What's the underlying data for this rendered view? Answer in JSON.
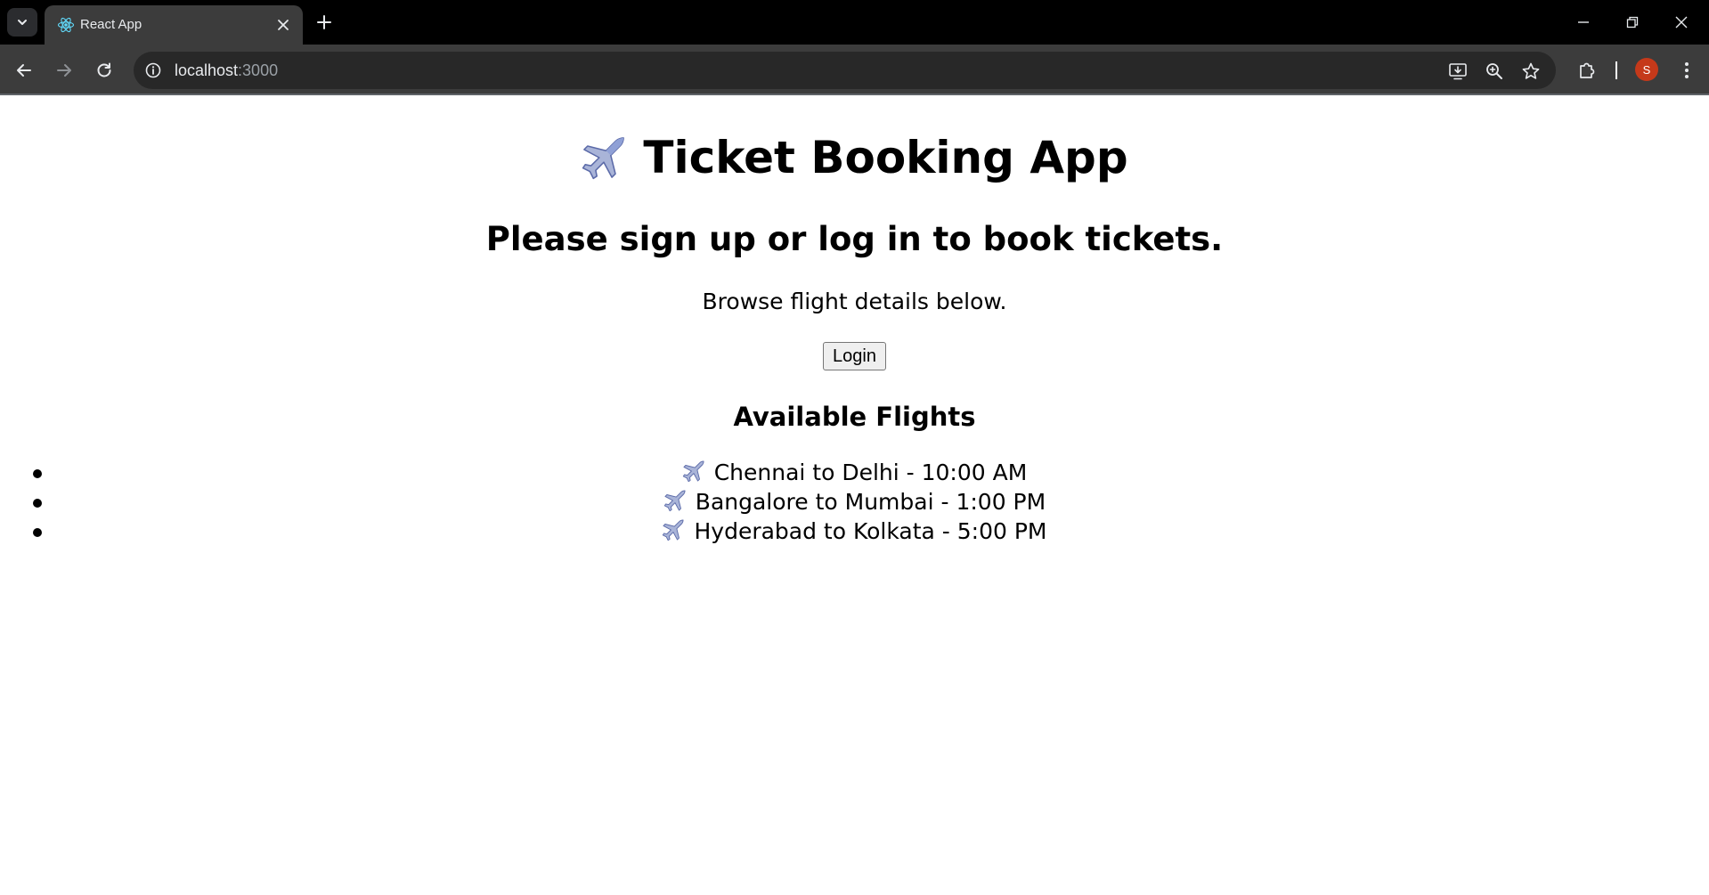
{
  "browser": {
    "tab_title": "React App",
    "url_host": "localhost",
    "url_port": ":3000",
    "profile_initial": "S",
    "colors": {
      "frame": "#000000",
      "toolbar": "#3c3c3c",
      "omnibox": "#282828",
      "avatar": "#c5391a",
      "react_favicon": "#61dafb"
    },
    "icons": {
      "tab_search": "chevron-down-icon",
      "favicon": "react-icon",
      "tab_close": "close-icon",
      "new_tab": "plus-icon",
      "minimize": "minimize-icon",
      "restore": "restore-icon",
      "close_window": "close-window-icon",
      "back": "arrow-left-icon",
      "forward": "arrow-right-icon",
      "reload": "reload-icon",
      "site_info": "info-icon",
      "install": "install-app-icon",
      "zoom": "zoom-icon",
      "bookmark": "star-icon",
      "extensions": "puzzle-icon",
      "menu": "kebab-menu-icon"
    }
  },
  "app": {
    "title_icon": "airplane-icon",
    "title": "Ticket Booking App",
    "subtitle": "Please sign up or log in to book tickets.",
    "browse_text": "Browse flight details below.",
    "login_label": "Login",
    "flights_heading": "Available Flights",
    "flights": [
      {
        "icon": "airplane-icon",
        "label": "Chennai to Delhi - 10:00 AM"
      },
      {
        "icon": "airplane-icon",
        "label": "Bangalore to Mumbai - 1:00 PM"
      },
      {
        "icon": "airplane-icon",
        "label": "Hyderabad to Kolkata - 5:00 PM"
      }
    ]
  }
}
